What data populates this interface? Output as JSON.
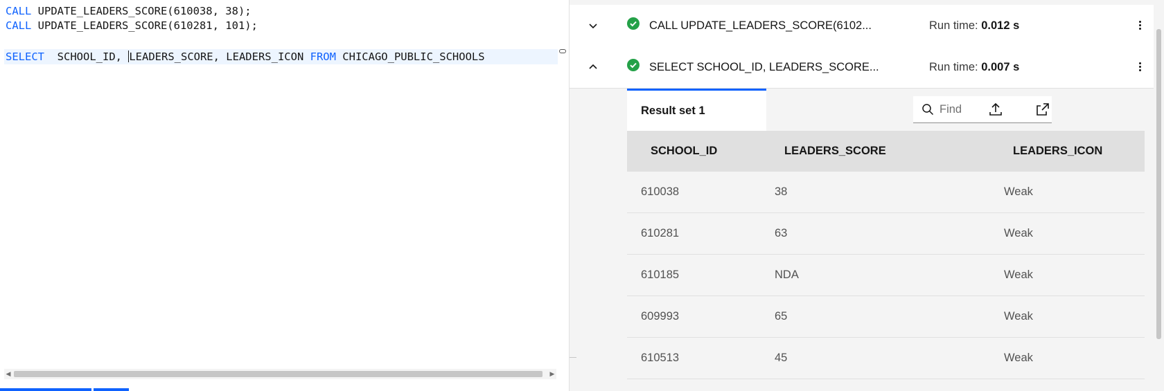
{
  "editor": {
    "lines": [
      {
        "kw": "CALL",
        "rest": " UPDATE_LEADERS_SCORE(610038, 38);"
      },
      {
        "kw": "CALL",
        "rest": " UPDATE_LEADERS_SCORE(610281, 101);"
      },
      {
        "kw": "SELECT",
        "pre": "  SCHOOL_ID, ",
        "mid": "LEADERS_SCORE, LEADERS_ICON ",
        "kw2": "FROM",
        "post": " CHICAGO_PUBLIC_SCHOOLS"
      }
    ]
  },
  "results": {
    "runs": [
      {
        "statement": "CALL UPDATE_LEADERS_SCORE(6102...",
        "runtime_label": "Run time:",
        "runtime": "0.012 s",
        "status": "success",
        "expanded": false,
        "chevron_icon": "chevron-down-icon"
      },
      {
        "statement": "SELECT SCHOOL_ID, LEADERS_SCORE...",
        "runtime_label": "Run time:",
        "runtime": "0.007 s",
        "status": "success",
        "expanded": true,
        "chevron_icon": "chevron-up-icon"
      }
    ],
    "tab_label": "Result set 1",
    "search": {
      "placeholder": "Find",
      "value": ""
    },
    "table": {
      "columns": [
        "SCHOOL_ID",
        "LEADERS_SCORE",
        "LEADERS_ICON"
      ],
      "rows": [
        [
          "610038",
          "38",
          "Weak"
        ],
        [
          "610281",
          "63",
          "Weak"
        ],
        [
          "610185",
          "NDA",
          "Weak"
        ],
        [
          "609993",
          "65",
          "Weak"
        ],
        [
          "610513",
          "45",
          "Weak"
        ]
      ]
    }
  },
  "colors": {
    "accent": "#0f62fe",
    "success": "#24a148",
    "keyword": "#0f62fe",
    "active_line": "#edf5ff",
    "table_header": "#e0e0e0",
    "table_row": "#f4f4f4"
  }
}
